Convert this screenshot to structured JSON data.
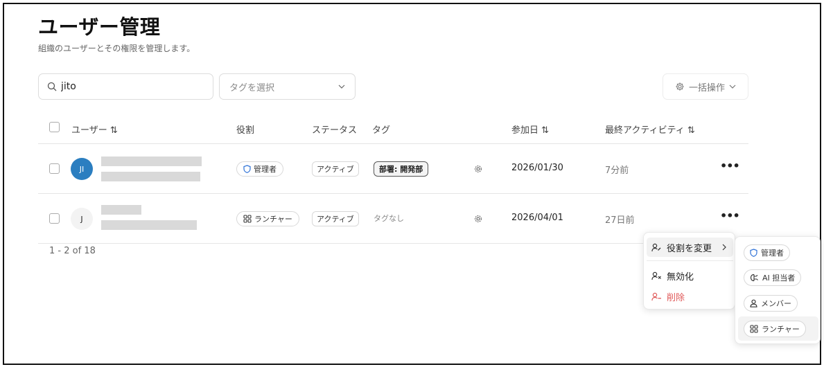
{
  "header": {
    "title": "ユーザー管理",
    "subtitle": "組織のユーザーとその権限を管理します。"
  },
  "toolbar": {
    "search_value": "jito",
    "tag_placeholder": "タグを選択",
    "bulk_label": "一括操作"
  },
  "table": {
    "columns": {
      "user": "ユーザー ⇅",
      "role": "役割",
      "status": "ステータス",
      "tag": "タグ",
      "joined": "参加日 ⇅",
      "last_activity": "最終アクティビティ ⇅"
    },
    "rows": [
      {
        "initials": "JI",
        "role": "管理者",
        "status": "アクティブ",
        "tag": "部署: 開発部",
        "joined": "2026/01/30",
        "activity": "7分前"
      },
      {
        "initials": "J",
        "role": "ランチャー",
        "status": "アクティブ",
        "tag": "タグなし",
        "joined": "2026/04/01",
        "activity": "27日前"
      }
    ]
  },
  "pagination": {
    "label": "1 - 2 of 18"
  },
  "context_menu": {
    "change_role": "役割を変更",
    "disable": "無効化",
    "delete": "削除"
  },
  "role_submenu": {
    "admin": "管理者",
    "ai_owner": "AI 担当者",
    "member": "メンバー",
    "launcher": "ランチャー"
  },
  "colors": {
    "accent_blue": "#2b7ec0",
    "danger": "#e05a5a",
    "shield_blue": "#2a6fd6"
  }
}
